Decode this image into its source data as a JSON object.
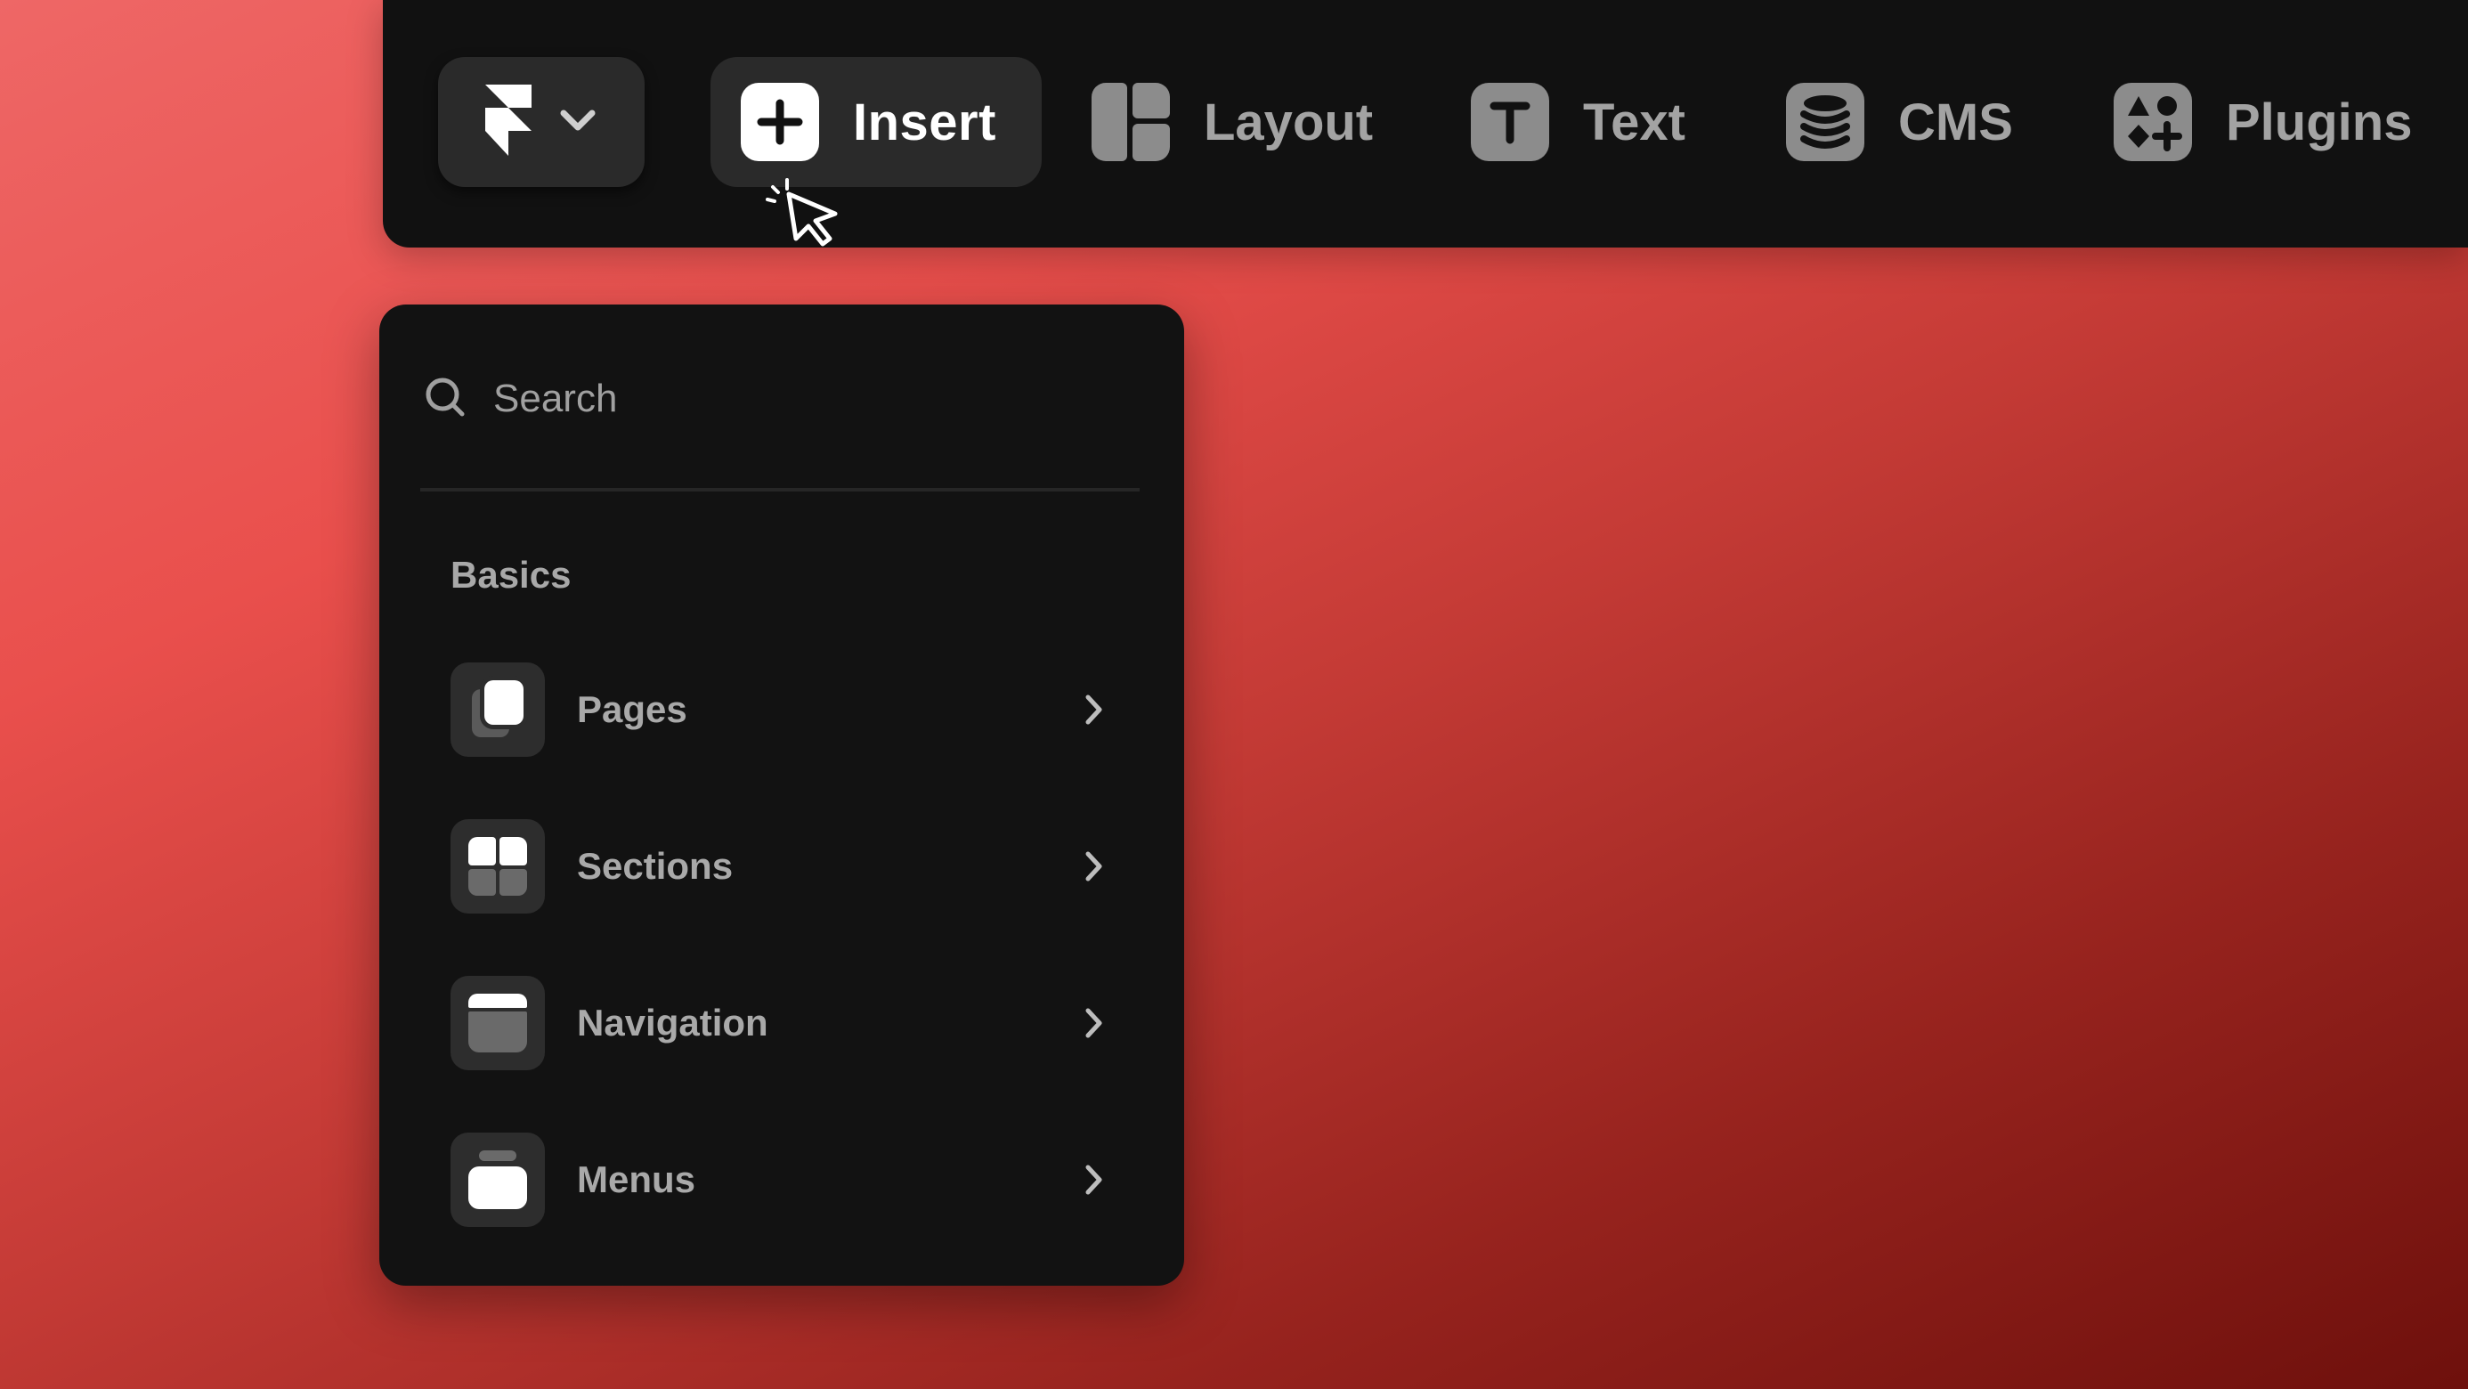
{
  "toolbar": {
    "logo_icon": "framer-logo-icon",
    "logo_dropdown_icon": "chevron-down-icon",
    "insert": {
      "label": "Insert",
      "icon": "plus-icon"
    },
    "items": [
      {
        "label": "Layout",
        "icon": "layout-icon"
      },
      {
        "label": "Text",
        "icon": "text-icon"
      },
      {
        "label": "CMS",
        "icon": "database-icon"
      },
      {
        "label": "Plugins",
        "icon": "plugins-icon"
      }
    ]
  },
  "panel": {
    "search": {
      "placeholder": "Search",
      "icon": "search-icon"
    },
    "section_title": "Basics",
    "items": [
      {
        "label": "Pages",
        "icon": "pages-icon"
      },
      {
        "label": "Sections",
        "icon": "sections-icon"
      },
      {
        "label": "Navigation",
        "icon": "navigation-icon"
      },
      {
        "label": "Menus",
        "icon": "menus-icon"
      }
    ]
  },
  "colors": {
    "toolbar_bg": "#111111",
    "panel_bg": "#121212",
    "button_bg": "#2a2a2a",
    "muted_text": "#a3a3a3",
    "icon_gray": "#8c8c8c",
    "background_top": "#ee6766",
    "background_bottom": "#6e100c"
  }
}
